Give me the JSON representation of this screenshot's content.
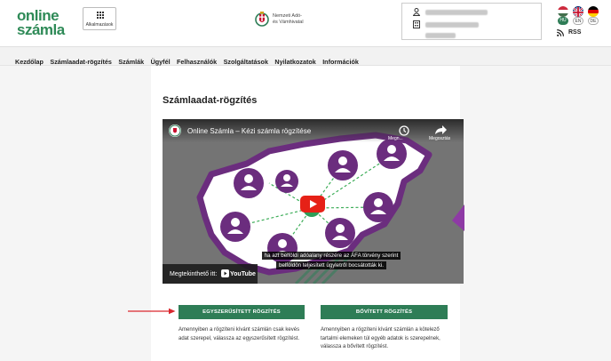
{
  "header": {
    "logo_line1": "online",
    "logo_line2": "számla",
    "apps_label": "Alkalmazások",
    "nav_line1": "Nemzeti Adó-",
    "nav_line2": "és Vámhivatal",
    "languages": [
      {
        "code": "HU",
        "active": true
      },
      {
        "code": "EN",
        "active": false
      },
      {
        "code": "DE",
        "active": false
      }
    ],
    "rss_label": "RSS"
  },
  "menu": {
    "items": [
      "Kezdőlap",
      "Számlaadat-rögzítés",
      "Számlák",
      "Ügyfél",
      "Felhasználók",
      "Szolgáltatások",
      "Nyilatkozatok",
      "Információk"
    ]
  },
  "page": {
    "title": "Számlaadat-rögzítés"
  },
  "video": {
    "title": "Online Számla – Kézi számla rögzítése",
    "clock_label": "Megn...",
    "share_label": "Megosztás",
    "caption_line1": "ha azt belföldi adóalany részére az ÁFA törvény szerint",
    "caption_line2": "belföldön teljesített ügyletről bocsátották ki.",
    "watch_on": "Megtekinthető itt:",
    "youtube": "YouTube"
  },
  "actions": {
    "simple_button": "EGYSZERŰSÍTETT RÖGZÍTÉS",
    "simple_desc": "Amennyiben a rögzíteni kívánt számlán csak kevés adat szerepel, válassza az egyszerűsített rögzítést.",
    "extended_button": "BŐVÍTETT RÖGZÍTÉS",
    "extended_desc": "Amennyiben a rögzíteni kívánt számlán a kötelező tartalmi elemeken túl egyéb adatok is szerepelnek, válassza a bővített rögzítést."
  },
  "colors": {
    "brand_green": "#2e8a57",
    "button_green": "#2e7d56",
    "arrow_red": "#d9272e",
    "map_purple": "#6b2d7e"
  }
}
